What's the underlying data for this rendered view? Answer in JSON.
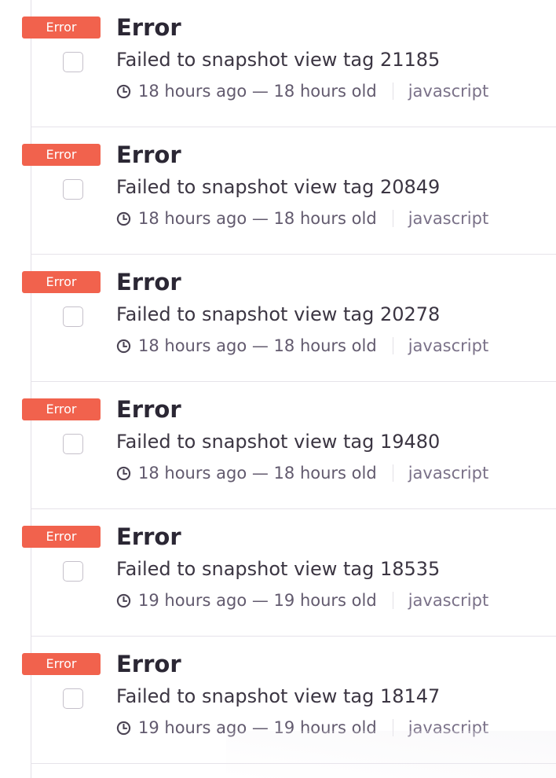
{
  "colors": {
    "badge": "#f1624d"
  },
  "issues": [
    {
      "level": "Error",
      "title": "Error",
      "message": "Failed to snapshot view tag 21185",
      "ago": "18 hours ago",
      "dash": "—",
      "age": "18 hours old",
      "platform": "javascript"
    },
    {
      "level": "Error",
      "title": "Error",
      "message": "Failed to snapshot view tag 20849",
      "ago": "18 hours ago",
      "dash": "—",
      "age": "18 hours old",
      "platform": "javascript"
    },
    {
      "level": "Error",
      "title": "Error",
      "message": "Failed to snapshot view tag 20278",
      "ago": "18 hours ago",
      "dash": "—",
      "age": "18 hours old",
      "platform": "javascript"
    },
    {
      "level": "Error",
      "title": "Error",
      "message": "Failed to snapshot view tag 19480",
      "ago": "18 hours ago",
      "dash": "—",
      "age": "18 hours old",
      "platform": "javascript"
    },
    {
      "level": "Error",
      "title": "Error",
      "message": "Failed to snapshot view tag 18535",
      "ago": "19 hours ago",
      "dash": "—",
      "age": "19 hours old",
      "platform": "javascript"
    },
    {
      "level": "Error",
      "title": "Error",
      "message": "Failed to snapshot view tag 18147",
      "ago": "19 hours ago",
      "dash": "—",
      "age": "19 hours old",
      "platform": "javascript"
    }
  ]
}
